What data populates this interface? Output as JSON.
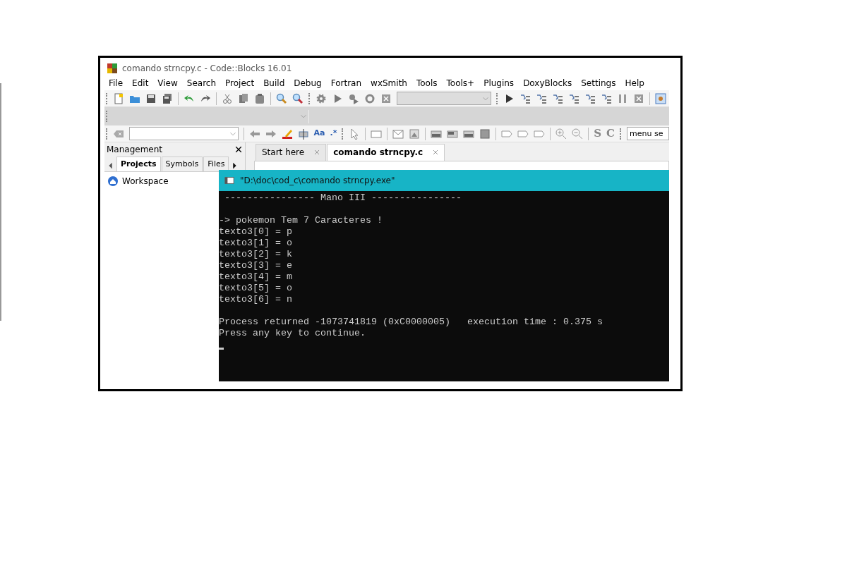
{
  "window": {
    "title": "comando strncpy.c - Code::Blocks 16.01"
  },
  "menu": [
    "File",
    "Edit",
    "View",
    "Search",
    "Project",
    "Build",
    "Debug",
    "Fortran",
    "wxSmith",
    "Tools",
    "Tools+",
    "Plugins",
    "DoxyBlocks",
    "Settings",
    "Help"
  ],
  "search_toolbar": {
    "glyphs": [
      "Aa",
      ".*"
    ],
    "style_glyphs": [
      "S",
      "C"
    ],
    "field_value": "menu se"
  },
  "management": {
    "title": "Management",
    "tabs": [
      {
        "label": "Projects",
        "selected": true
      },
      {
        "label": "Symbols",
        "selected": false
      },
      {
        "label": "Files",
        "selected": false
      }
    ],
    "tree": [
      {
        "label": "Workspace"
      }
    ]
  },
  "editor": {
    "tabs": [
      {
        "label": "Start here",
        "selected": false
      },
      {
        "label": "comando strncpy.c",
        "selected": true
      }
    ]
  },
  "console": {
    "title": "\"D:\\doc\\cod_c\\comando strncpy.exe\"",
    "blocks": [
      [
        " ---------------- Mano III ----------------"
      ],
      [
        "-> pokemon Tem 7 Caracteres !",
        "texto3[0] = p",
        "texto3[1] = o",
        "texto3[2] = k",
        "texto3[3] = e",
        "texto3[4] = m",
        "texto3[5] = o",
        "texto3[6] = n"
      ],
      [
        "Process returned -1073741819 (0xC0000005)   execution time : 0.375 s",
        "Press any key to continue."
      ]
    ]
  }
}
